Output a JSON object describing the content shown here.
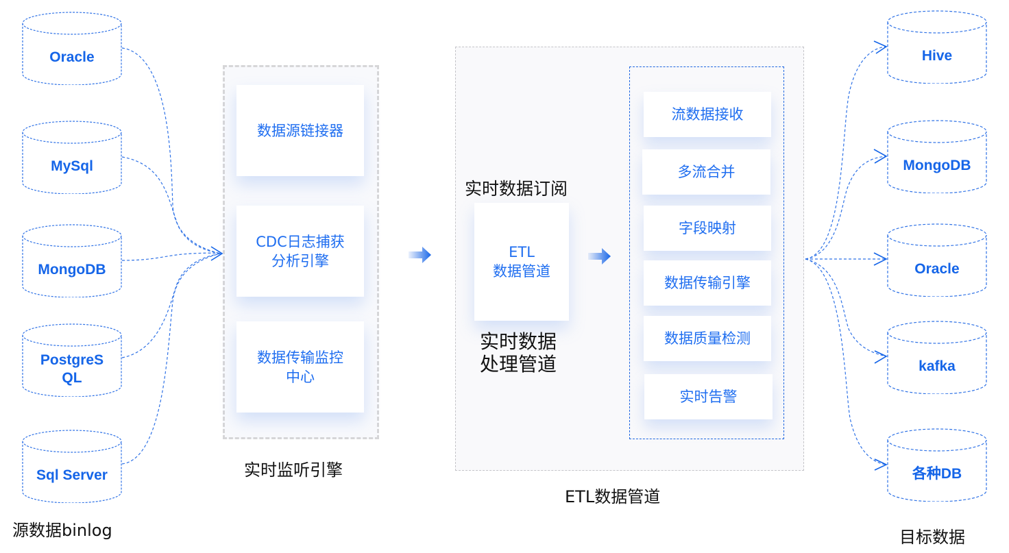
{
  "sources": {
    "caption": "源数据binlog",
    "items": [
      "Oracle",
      "MySql",
      "MongoDB",
      "PostgreS\nQL",
      "Sql Server"
    ]
  },
  "listener": {
    "caption": "实时监听引擎",
    "cards": [
      "数据源链接器",
      "CDC日志捕获\n分析引擎",
      "数据传输监控\n中心"
    ]
  },
  "etl": {
    "caption": "ETL数据管道",
    "subscribe_label": "实时数据订阅",
    "pipeline_card": "ETL\n数据管道",
    "pipeline_caption": "实时数据\n处理管道",
    "steps": [
      "流数据接收",
      "多流合并",
      "字段映射",
      "数据传输引擎",
      "数据质量检测",
      "实时告警"
    ]
  },
  "targets": {
    "caption": "目标数据",
    "items": [
      "Hive",
      "MongoDB",
      "Oracle",
      "kafka",
      "各种DB"
    ]
  },
  "colors": {
    "accent": "#1565e8",
    "dash": "#2f72e6",
    "grey_border": "#d6d6d8"
  }
}
